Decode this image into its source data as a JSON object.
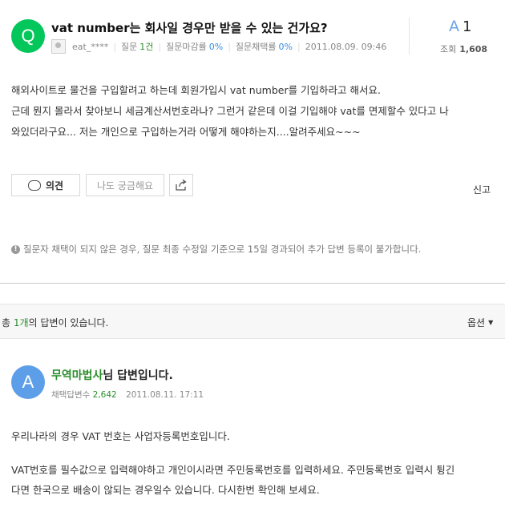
{
  "question": {
    "avatar_letter": "Q",
    "title": "vat number는 회사일 경우만 받을 수 있는 건가요?",
    "author": "eat_****",
    "question_label": "질문",
    "question_count": "1건",
    "deadline_label": "질문마감률",
    "deadline_rate": "0%",
    "adopt_label": "질문채택률",
    "adopt_rate": "0%",
    "date": "2011.08.09. 09:46",
    "answer_letter": "A",
    "answer_count": "1",
    "views_label": "조회",
    "views": "1,608",
    "body": [
      "해외사이트로 물건을 구입할려고 하는데 회원가입시 vat number를 기입하라고 해서요.",
      "근데 뭔지 몰라서 찾아보니 세금계산서번호라나? 그런거 같은데 이걸 기입해야 vat를 면제할수 있다고 나",
      "와있더라구요... 저는 개인으로 구입하는거라 어떻게 해야하는지....알려주세요~~~"
    ]
  },
  "actions": {
    "opinion_label": "의견",
    "curious_label": "나도 궁금해요",
    "report_label": "신고"
  },
  "notice": "질문자 채택이 되지 않은 경우, 질문 최종 수정일 기준으로 15일 경과되어 추가 답변 등록이 불가합니다.",
  "answers_bar": {
    "prefix": "총 ",
    "count": "1개",
    "suffix": "의 답변이 있습니다.",
    "options_label": "옵션"
  },
  "answer": {
    "avatar_letter": "A",
    "author": "무역마법사",
    "title_suffix": "님 답변입니다.",
    "adopted_label": "채택답변수",
    "adopted_count": "2,642",
    "date": "2011.08.11. 17:11",
    "body": [
      "우리나라의 경우 VAT 번호는 사업자등록번호입니다.",
      "VAT번호를 필수값으로 입력해야하고 개인이시라면 주민등록번호를 입력하세요. 주민등록번호 입력시 튕긴",
      "다면 한국으로 배송이 않되는 경우일수 있습니다. 다시한번 확인해 보세요."
    ]
  }
}
